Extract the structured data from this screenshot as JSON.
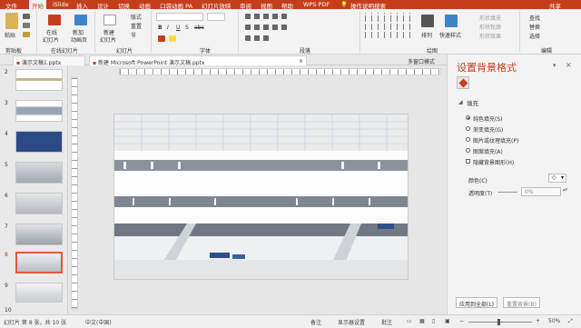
{
  "menu": {
    "items": [
      "文件",
      "开始",
      "iSlide",
      "插入",
      "设计",
      "切换",
      "动画",
      "口袋动画 PA",
      "幻灯片放映",
      "审阅",
      "视图",
      "帮助",
      "WPS PDF",
      "操作说明搜索"
    ],
    "share": "共享"
  },
  "ribbon": {
    "paste": "粘贴",
    "loop_play": "在线幻灯片",
    "loop_play_l1": "在线",
    "loop_play_l2": "幻灯片",
    "new_anim": "新建动画页",
    "new_anim_l1": "新加",
    "new_anim_l2": "动画页",
    "new_slide_l1": "新建",
    "new_slide_l2": "幻灯片",
    "layout": "版式",
    "reset": "重置",
    "section": "节",
    "font_b": "B",
    "font_i": "I",
    "font_u": "U",
    "font_s": "S",
    "font_abc": "abc",
    "arrange": "排列",
    "quick_styles": "快速样式",
    "shape_fill": "形状填充",
    "shape_outline": "形状轮廓",
    "shape_effects": "形状效果",
    "find": "查找",
    "replace": "替换",
    "select": "选择",
    "groups": [
      "剪贴板",
      "在线幻灯片",
      "幻灯片",
      "字体",
      "段落",
      "绘图",
      "编辑"
    ]
  },
  "tabs": {
    "tab1": "演示文稿1.pptx",
    "tab2": "新建 Microsoft PowerPoint 演示文稿.pptx",
    "tab3": "多窗口模式"
  },
  "thumbnails": {
    "numbers": [
      "2",
      "3",
      "4",
      "5",
      "6",
      "7",
      "8",
      "9",
      "10"
    ],
    "selected": "8"
  },
  "pane": {
    "title": "设置背景格式",
    "section": "填充",
    "options": [
      "纯色填充(S)",
      "渐变填充(G)",
      "图片或纹理填充(P)",
      "图案填充(A)"
    ],
    "hide_graphics": "隐藏背景图形(H)",
    "color_label": "颜色(C)",
    "transparency_label": "透明度(T)",
    "transparency_value": "0%",
    "apply_all": "应用到全部(L)",
    "reset_bg": "重置背景(B)"
  },
  "status": {
    "slide": "幻灯片 第 8 张，共 10 张",
    "lang": "中文(中国)",
    "notes": "备注",
    "display": "显示器设置",
    "comments": "批注",
    "zoom": "50%"
  }
}
